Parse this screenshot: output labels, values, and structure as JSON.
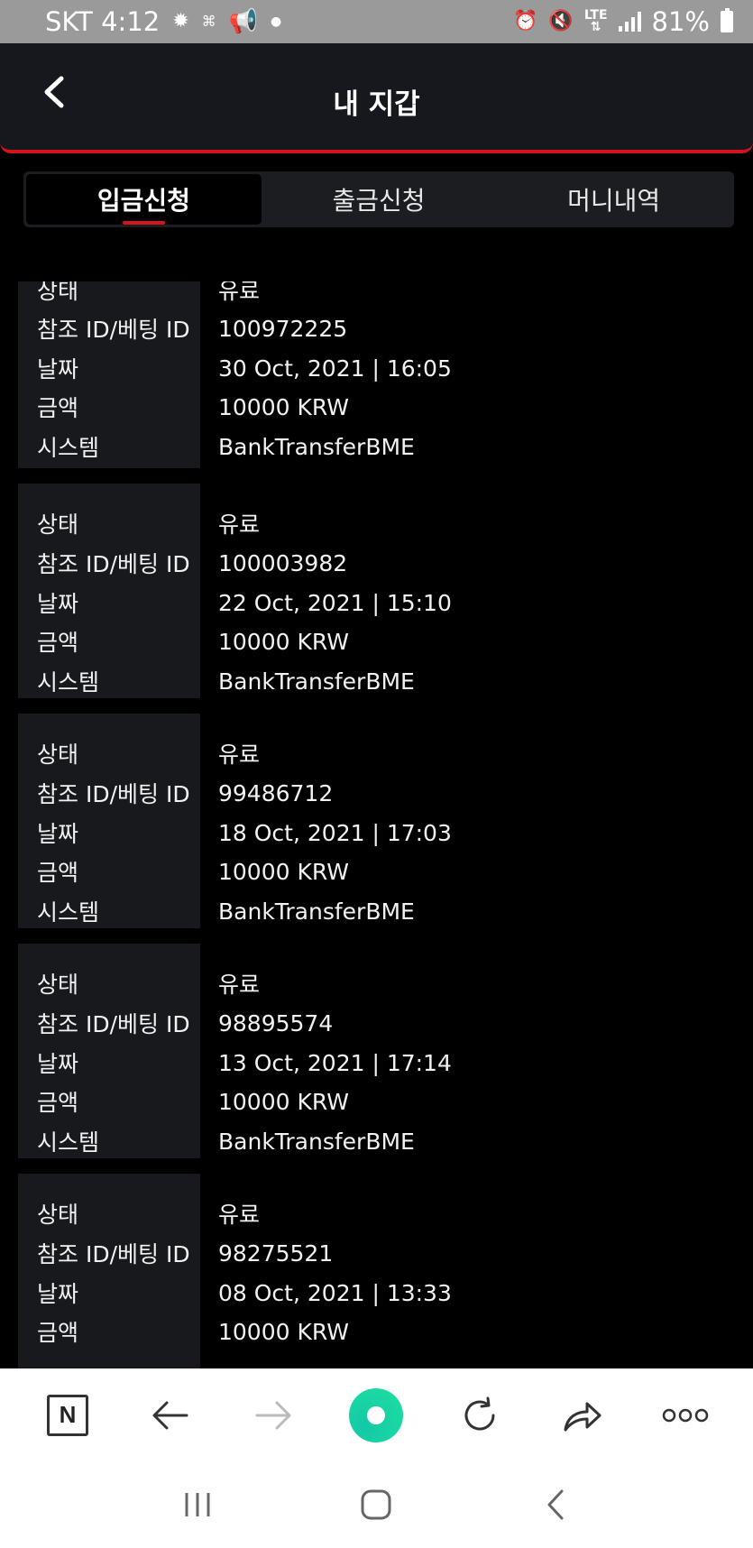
{
  "status_bar": {
    "carrier_time": "SKT 4:12",
    "battery": "81%",
    "network": "LTE"
  },
  "header": {
    "title": "내 지갑"
  },
  "tabs": [
    {
      "label": "입금신청",
      "active": true
    },
    {
      "label": "출금신청",
      "active": false
    },
    {
      "label": "머니내역",
      "active": false
    }
  ],
  "field_labels": {
    "status": "상태",
    "ref_id": "참조 ID/베팅 ID",
    "date": "날짜",
    "amount": "금액",
    "system": "시스템"
  },
  "transactions": [
    {
      "status": "유료",
      "ref_id": "100972225",
      "date": "30 Oct, 2021 | 16:05",
      "amount": "10000 KRW",
      "system": "BankTransferBME"
    },
    {
      "status": "유료",
      "ref_id": "100003982",
      "date": "22 Oct, 2021 | 15:10",
      "amount": "10000 KRW",
      "system": "BankTransferBME"
    },
    {
      "status": "유료",
      "ref_id": "99486712",
      "date": "18 Oct, 2021 | 17:03",
      "amount": "10000 KRW",
      "system": "BankTransferBME"
    },
    {
      "status": "유료",
      "ref_id": "98895574",
      "date": "13 Oct, 2021 | 17:14",
      "amount": "10000 KRW",
      "system": "BankTransferBME"
    },
    {
      "status": "유료",
      "ref_id": "98275521",
      "date": "08 Oct, 2021 | 13:33",
      "amount": "10000 KRW",
      "system": ""
    }
  ],
  "toolbar": {
    "n_label": "N",
    "icons": [
      "naver-n-icon",
      "back-arrow-icon",
      "forward-arrow-icon",
      "home-green-icon",
      "reload-icon",
      "share-icon",
      "more-icon"
    ]
  },
  "colors": {
    "accent": "#d4141c",
    "home_green": "#1fd6a4",
    "label_bg": "#18191d"
  }
}
